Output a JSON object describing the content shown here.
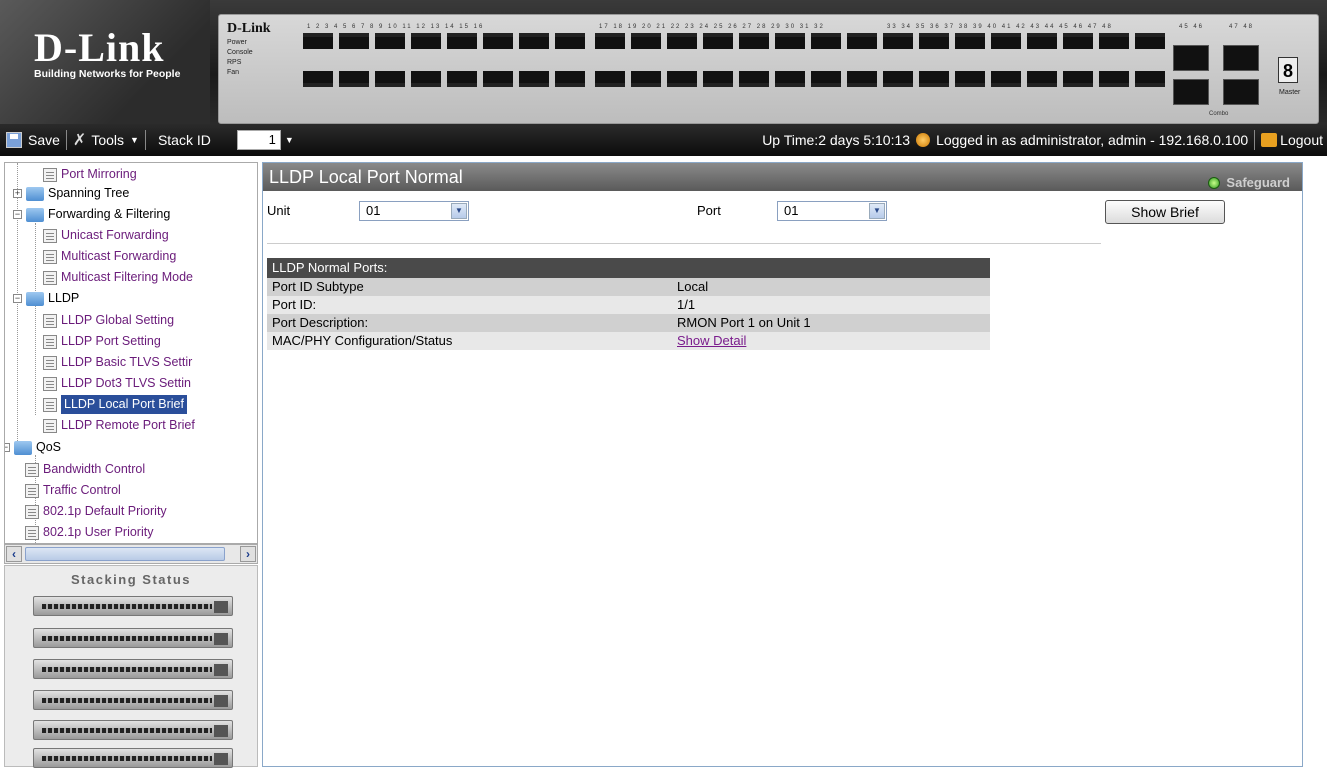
{
  "banner": {
    "logo": "D-Link",
    "tagline": "Building Networks for People",
    "panel_brand": "D-Link",
    "panel_leds": [
      "Power",
      "Console",
      "RPS",
      "Fan"
    ],
    "port_numbers_1": "1 2 3 4 5 6 7 8 9 10 11 12 13 14 15 16",
    "port_numbers_2": "17 18 19 20 21 22 23 24 25 26 27 28 29 30 31 32",
    "port_numbers_3": "33 34 35 36 37 38 39 40 41 42 43 44 45 46 47 48",
    "sfp_numbers_1": "45 46",
    "sfp_numbers_2": "47 48",
    "combo_label": "Combo",
    "master_label": "Master",
    "stack_display": "8"
  },
  "toolbar": {
    "save_label": "Save",
    "tools_label": "Tools",
    "stack_id_label": "Stack ID",
    "stack_id_value": "1",
    "status_text": "Up Time:2 days 5:10:13",
    "login_text": "Logged in as administrator, admin - 192.168.0.100",
    "logout_label": "Logout"
  },
  "tree": {
    "items": [
      {
        "label": "Port Mirroring"
      },
      {
        "label": "Spanning Tree"
      },
      {
        "label": "Forwarding & Filtering"
      },
      {
        "label": "Unicast Forwarding"
      },
      {
        "label": "Multicast Forwarding"
      },
      {
        "label": "Multicast Filtering Mode"
      },
      {
        "label": "LLDP"
      },
      {
        "label": "LLDP Global Setting"
      },
      {
        "label": "LLDP Port Setting"
      },
      {
        "label": "LLDP Basic TLVS Settir"
      },
      {
        "label": "LLDP Dot3 TLVS Settin"
      },
      {
        "label": "LLDP Local Port Brief"
      },
      {
        "label": "LLDP Remote Port Brief"
      },
      {
        "label": "QoS"
      },
      {
        "label": "Bandwidth Control"
      },
      {
        "label": "Traffic Control"
      },
      {
        "label": "802.1p Default Priority"
      },
      {
        "label": "802.1p User Priority"
      }
    ]
  },
  "stacking": {
    "title": "Stacking Status"
  },
  "main": {
    "title": "LLDP Local Port Normal",
    "safeguard": "Safeguard",
    "unit_label": "Unit",
    "unit_value": "01",
    "port_label": "Port",
    "port_value": "01",
    "show_brief_label": "Show Brief",
    "table": {
      "header": "LLDP Normal Ports:",
      "rows": [
        {
          "name": "Port ID Subtype",
          "value": "Local"
        },
        {
          "name": "Port ID:",
          "value": "1/1"
        },
        {
          "name": "Port Description:",
          "value": "RMON Port 1 on Unit 1"
        },
        {
          "name": "MAC/PHY Configuration/Status",
          "value": "Show Detail"
        }
      ]
    }
  }
}
